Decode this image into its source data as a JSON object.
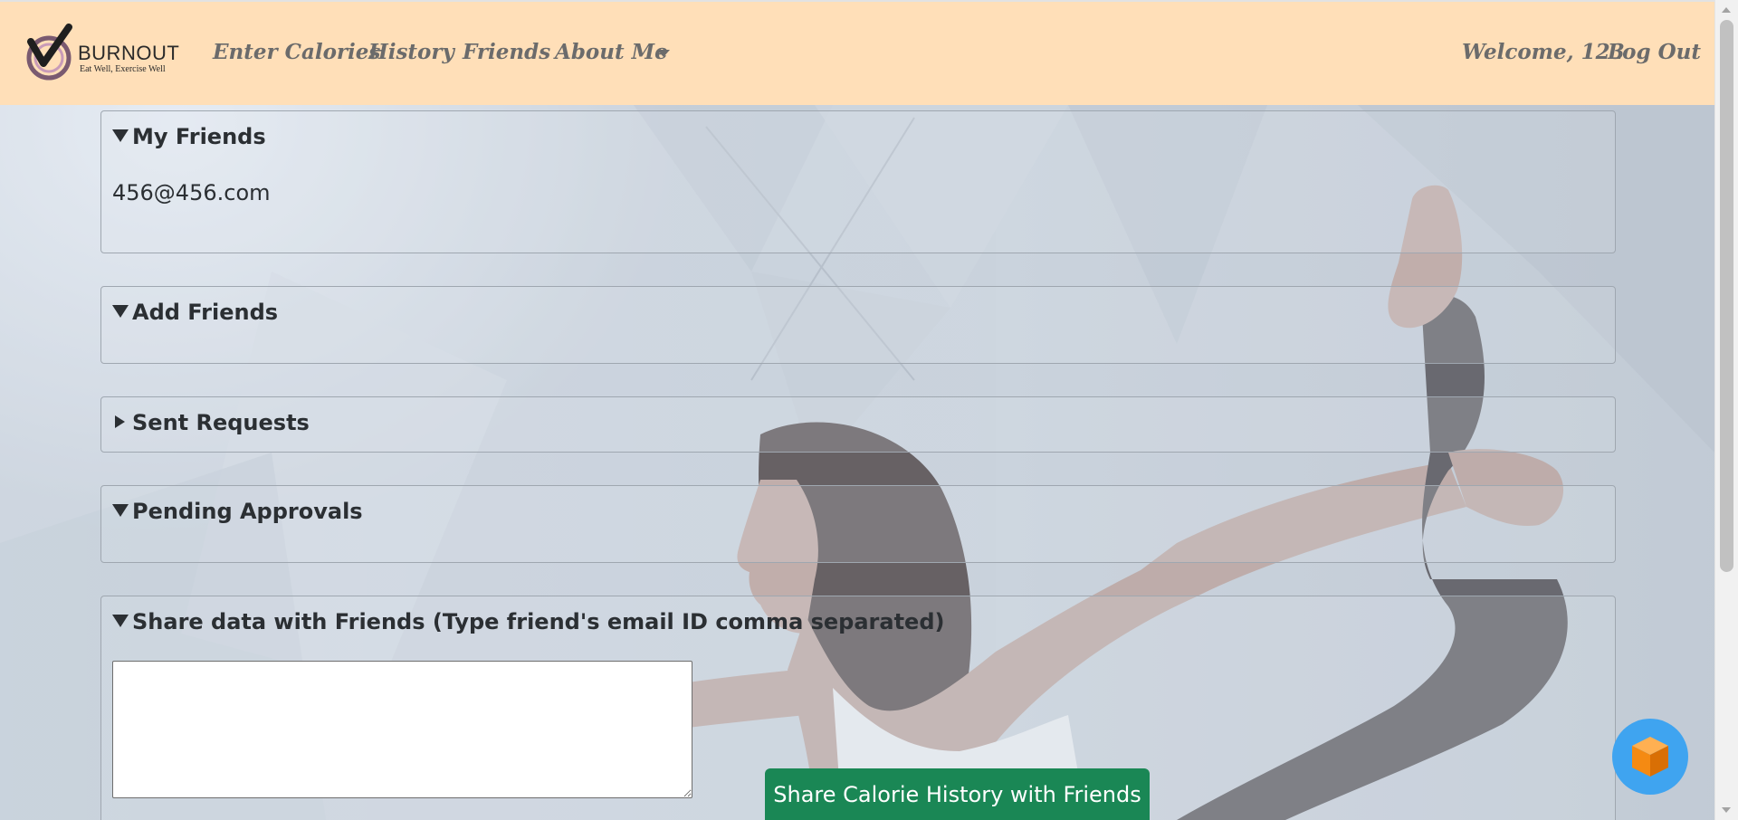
{
  "brand": {
    "name": "BURNOUT",
    "tagline": "Eat Well, Exercise Well"
  },
  "nav": {
    "enter_calories": "Enter Calories",
    "history": "History",
    "friends": "Friends",
    "about_me": "About Me",
    "welcome": "Welcome, 123",
    "logout": "Log Out"
  },
  "sections": {
    "my_friends": {
      "title": "My Friends",
      "expanded": true,
      "items": [
        "456@456.com"
      ]
    },
    "add_friends": {
      "title": "Add Friends",
      "expanded": true
    },
    "sent_requests": {
      "title": "Sent Requests",
      "expanded": false
    },
    "pending_approvals": {
      "title": "Pending Approvals",
      "expanded": true
    },
    "share_data": {
      "title": "Share data with Friends (Type friend's email ID comma separated)",
      "expanded": true,
      "input_value": "",
      "button_label": "Share Calorie History with Friends"
    }
  },
  "colors": {
    "navbar_bg": "#ffdfb8",
    "nav_text": "#6b6b6b",
    "share_button": "#1a8755",
    "fab": "#3fa4f0",
    "fab_icon": "#f58a12"
  },
  "icons": {
    "logo": "burnout-check-logo",
    "fab": "orange-cube-icon"
  }
}
